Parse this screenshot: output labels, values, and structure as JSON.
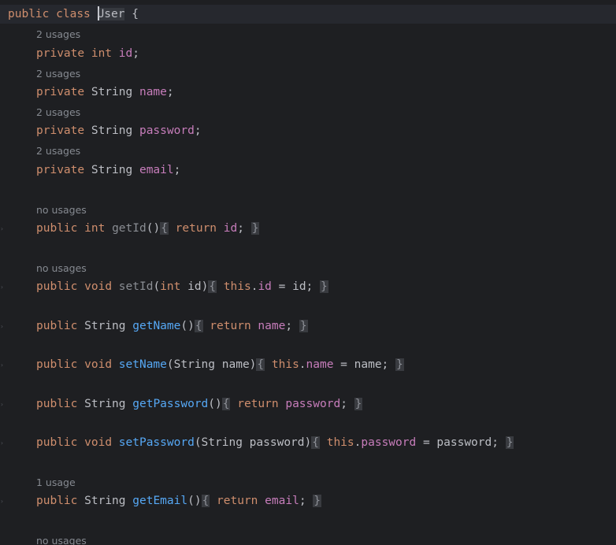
{
  "class_declaration": {
    "kw_public": "public",
    "kw_class": "class",
    "class_name_first": "U",
    "class_name_rest": "ser",
    "brace": "{"
  },
  "fields": [
    {
      "usage_hint": "2 usages",
      "modifier": "private",
      "type": "int",
      "name": "id",
      "end": ";"
    },
    {
      "usage_hint": "2 usages",
      "modifier": "private",
      "type": "String",
      "name": "name",
      "end": ";"
    },
    {
      "usage_hint": "2 usages",
      "modifier": "private",
      "type": "String",
      "name": "password",
      "end": ";"
    },
    {
      "usage_hint": "2 usages",
      "modifier": "private",
      "type": "String",
      "name": "email",
      "end": ";"
    }
  ],
  "methods": [
    {
      "usage_hint": "no usages",
      "modifier": "public",
      "return_type": "int",
      "name": "getId",
      "params": "()",
      "body_kw": "return",
      "body_field": "id",
      "body_rest": ";",
      "greyed_name": true
    },
    {
      "usage_hint": "no usages",
      "modifier": "public",
      "return_type": "void",
      "name": "setId",
      "params_open": "(",
      "param_type": "int",
      "param_name": "id",
      "params_close": ")",
      "this_kw": "this",
      "field": "id",
      "assign": " = id;",
      "greyed_name": true
    },
    {
      "modifier": "public",
      "return_type": "String",
      "name": "getName",
      "params": "()",
      "body_kw": "return",
      "body_field": "name",
      "body_rest": ";"
    },
    {
      "modifier": "public",
      "return_type": "void",
      "name": "setName",
      "params_open": "(",
      "param_type": "String",
      "param_name": "name",
      "params_close": ")",
      "this_kw": "this",
      "field": "name",
      "assign": " = name;"
    },
    {
      "modifier": "public",
      "return_type": "String",
      "name": "getPassword",
      "params": "()",
      "body_kw": "return",
      "body_field": "password",
      "body_rest": ";"
    },
    {
      "modifier": "public",
      "return_type": "void",
      "name": "setPassword",
      "params_open": "(",
      "param_type": "String",
      "param_name": "password",
      "params_close": ")",
      "this_kw": "this",
      "field": "password",
      "assign": " = password;"
    },
    {
      "usage_hint": "1 usage",
      "modifier": "public",
      "return_type": "String",
      "name": "getEmail",
      "params": "()",
      "body_kw": "return",
      "body_field": "email",
      "body_rest": ";"
    }
  ],
  "trailing_hint": "no usages",
  "fold_open": "{",
  "fold_close": "}",
  "colors": {
    "background": "#1e1f22",
    "keyword": "#cf8e6d",
    "field": "#c77dbb",
    "method": "#56a8f5",
    "text": "#bcbec4",
    "hint": "#868a91",
    "fold_bg": "#393b40"
  }
}
